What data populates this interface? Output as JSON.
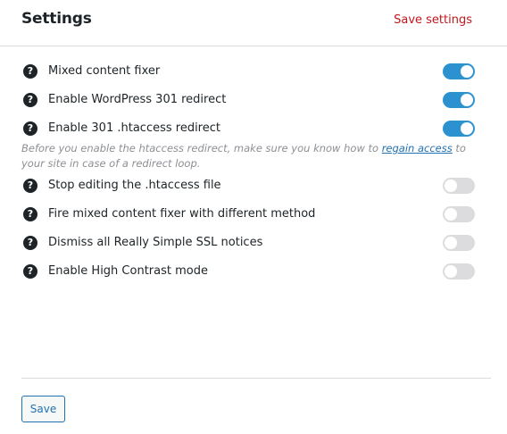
{
  "header": {
    "title": "Settings",
    "save_link": "Save settings"
  },
  "settings_top": [
    {
      "label": "Mixed content fixer",
      "enabled": true
    },
    {
      "label": "Enable WordPress 301 redirect",
      "enabled": true
    },
    {
      "label": "Enable 301 .htaccess redirect",
      "enabled": true
    }
  ],
  "notice": {
    "before": "Before you enable the htaccess redirect, make sure you know how to ",
    "link": "regain access",
    "after": " to your site in case of a redirect loop."
  },
  "settings_bottom": [
    {
      "label": "Stop editing the .htaccess file",
      "enabled": false
    },
    {
      "label": "Fire mixed content fixer with different method",
      "enabled": false
    },
    {
      "label": "Dismiss all Really Simple SSL notices",
      "enabled": false
    },
    {
      "label": "Enable High Contrast mode",
      "enabled": false
    }
  ],
  "help_icon_glyph": "?",
  "footer": {
    "save_label": "Save"
  },
  "colors": {
    "toggle_on": "#2b92cf",
    "toggle_off": "#dcdcde",
    "accent_link": "#c3171c",
    "primary": "#2271b1"
  }
}
